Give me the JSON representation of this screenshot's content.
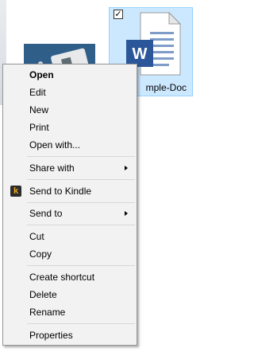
{
  "desktop": {
    "file": {
      "name": "Sample-Doc",
      "visible_label": "mple-Doc",
      "selected": true,
      "icon": "word-document-icon",
      "icon_letter": "W",
      "accent": "#2b579a"
    },
    "photo_thumbnail": {
      "icon": "image-thumbnail"
    }
  },
  "context_menu": {
    "items": [
      {
        "label": "Open",
        "bold": true
      },
      {
        "label": "Edit"
      },
      {
        "label": "New"
      },
      {
        "label": "Print"
      },
      {
        "label": "Open with..."
      },
      {
        "label": "Share with",
        "submenu": true
      },
      {
        "label": "Send to Kindle",
        "icon": "kindle-icon",
        "icon_text": "k"
      },
      {
        "label": "Send to",
        "submenu": true
      },
      {
        "label": "Cut"
      },
      {
        "label": "Copy"
      },
      {
        "label": "Create shortcut"
      },
      {
        "label": "Delete"
      },
      {
        "label": "Rename"
      },
      {
        "label": "Properties"
      }
    ]
  },
  "colors": {
    "selection_fill": "#cce8ff",
    "selection_border": "#99d1ff",
    "menu_background": "#f2f2f2",
    "kindle_orange": "#f0a81f"
  }
}
